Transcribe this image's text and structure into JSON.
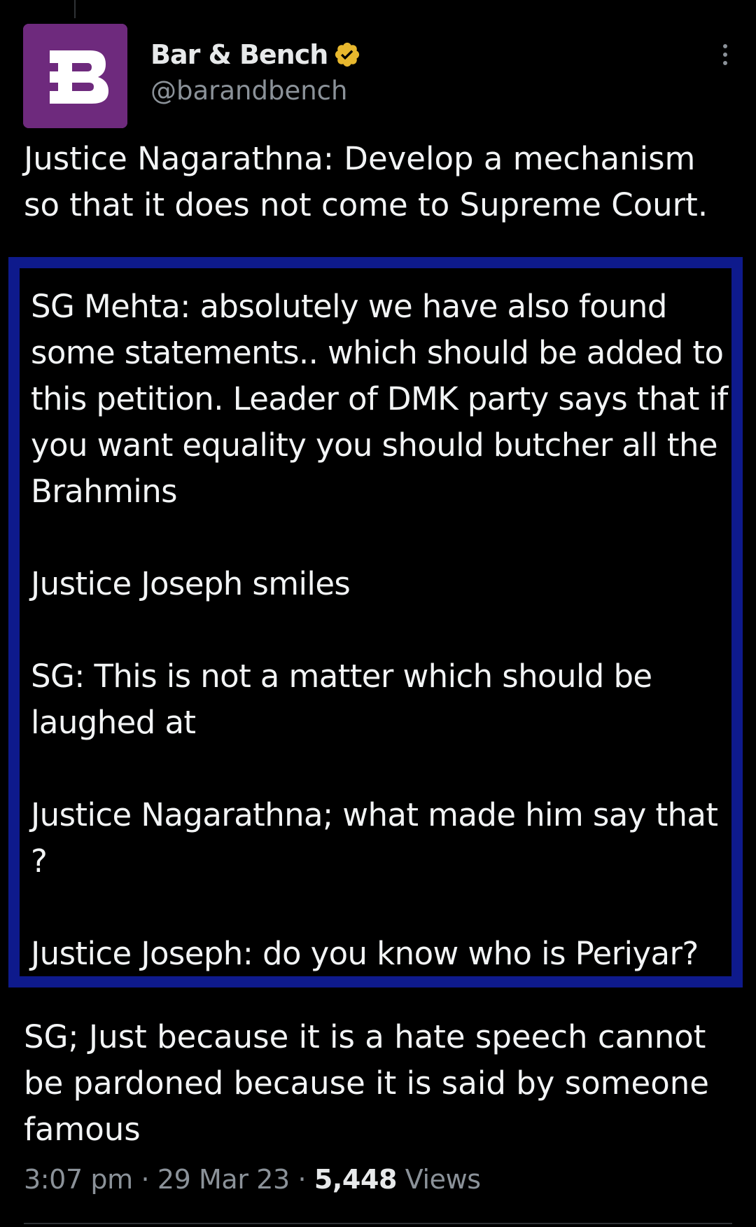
{
  "author": {
    "display_name": "Bar & Bench",
    "handle": "@barandbench",
    "avatar_letter": "B",
    "avatar_color": "#6e2a7d",
    "verified_color": "#e8b82e",
    "verified_icon": "verified-badge-icon"
  },
  "tweet": {
    "intro": "Justice Nagarathna: Develop a mechanism so that it does not come to Supreme Court.",
    "highlighted": [
      "SG Mehta: absolutely we have also found some statements.. which should be added to this petition. Leader of DMK party says that if you want equality you should butcher all the Brahmins",
      "Justice Joseph smiles",
      "SG: This is not a matter which should be laughed at",
      "Justice Nagarathna; what made him say that ?",
      "Justice Joseph: do you know who is Periyar?"
    ],
    "outro": "SG; Just because it is a hate speech cannot be pardoned because it is said by someone famous",
    "highlight_border_color": "#0e1a8c"
  },
  "meta": {
    "time": "3:07 pm",
    "separator": "·",
    "date": "29 Mar 23",
    "views_count": "5,448",
    "views_label": "Views"
  },
  "icons": {
    "more": "more-options-icon"
  }
}
